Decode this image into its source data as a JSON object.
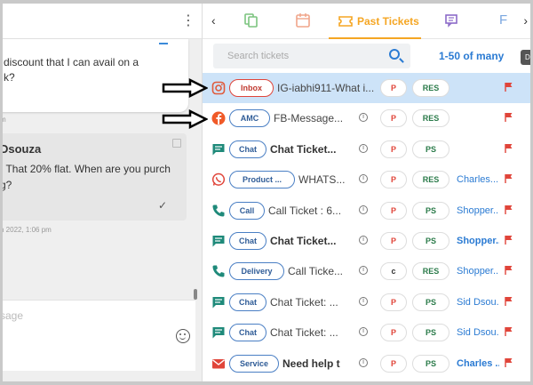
{
  "chat": {
    "message1_text": "discount that I can avail on a\nk?",
    "time1": "m",
    "message2_name": "Dsouza",
    "message2_text": ", That 20% flat. When are you purch\ng?",
    "time2": "h 2022, 1:06 pm",
    "compose_placeholder": "sage"
  },
  "tabs": {
    "active_label": "Past Tickets",
    "partial_label": "F"
  },
  "search": {
    "placeholder": "Search tickets",
    "pager": "1-50 of many",
    "badge": "D"
  },
  "colors": {
    "accent_orange": "#f5a623",
    "link_blue": "#2b7bd3",
    "selected_row": "#cde3f8",
    "flag_red": "#e0453a"
  },
  "tickets": [
    {
      "channel_icon": "instagram-icon",
      "channel": "Inbox",
      "title": "IG-iabhi911-What i...",
      "info": "",
      "priority": "P",
      "status": "RES",
      "agent": ""
    },
    {
      "channel_icon": "facebook-icon",
      "channel": "AMC",
      "title": "FB-Message...",
      "info": "i",
      "priority": "P",
      "status": "RES",
      "agent": ""
    },
    {
      "channel_icon": "chat-icon",
      "channel": "Chat",
      "title": "Chat Ticket...",
      "info": "i",
      "priority": "P",
      "status": "PS",
      "agent": ""
    },
    {
      "channel_icon": "whatsapp-icon",
      "channel": "Product ...",
      "title": "WHATS...",
      "info": "i",
      "priority": "P",
      "status": "RES",
      "agent": "Charles..."
    },
    {
      "channel_icon": "phone-icon",
      "channel": "Call",
      "title": "Call Ticket : 6...",
      "info": "i",
      "priority": "P",
      "status": "PS",
      "agent": "Shopper..."
    },
    {
      "channel_icon": "chat-icon",
      "channel": "Chat",
      "title": "Chat Ticket...",
      "info": "i",
      "priority": "P",
      "status": "PS",
      "agent": "Shopper..."
    },
    {
      "channel_icon": "phone-icon",
      "channel": "Delivery",
      "title": "Call Ticke...",
      "info": "i",
      "priority": "c",
      "status": "RES",
      "agent": "Shopper..."
    },
    {
      "channel_icon": "chat-icon",
      "channel": "Chat",
      "title": "Chat Ticket: ...",
      "info": "i",
      "priority": "P",
      "status": "PS",
      "agent": "Sid Dsou..."
    },
    {
      "channel_icon": "chat-icon",
      "channel": "Chat",
      "title": "Chat Ticket: ...",
      "info": "i",
      "priority": "P",
      "status": "PS",
      "agent": "Sid Dsou..."
    },
    {
      "channel_icon": "email-icon",
      "channel": "Service",
      "title": "Need help t",
      "info": "i",
      "priority": "P",
      "status": "PS",
      "agent": "Charles ..."
    }
  ]
}
